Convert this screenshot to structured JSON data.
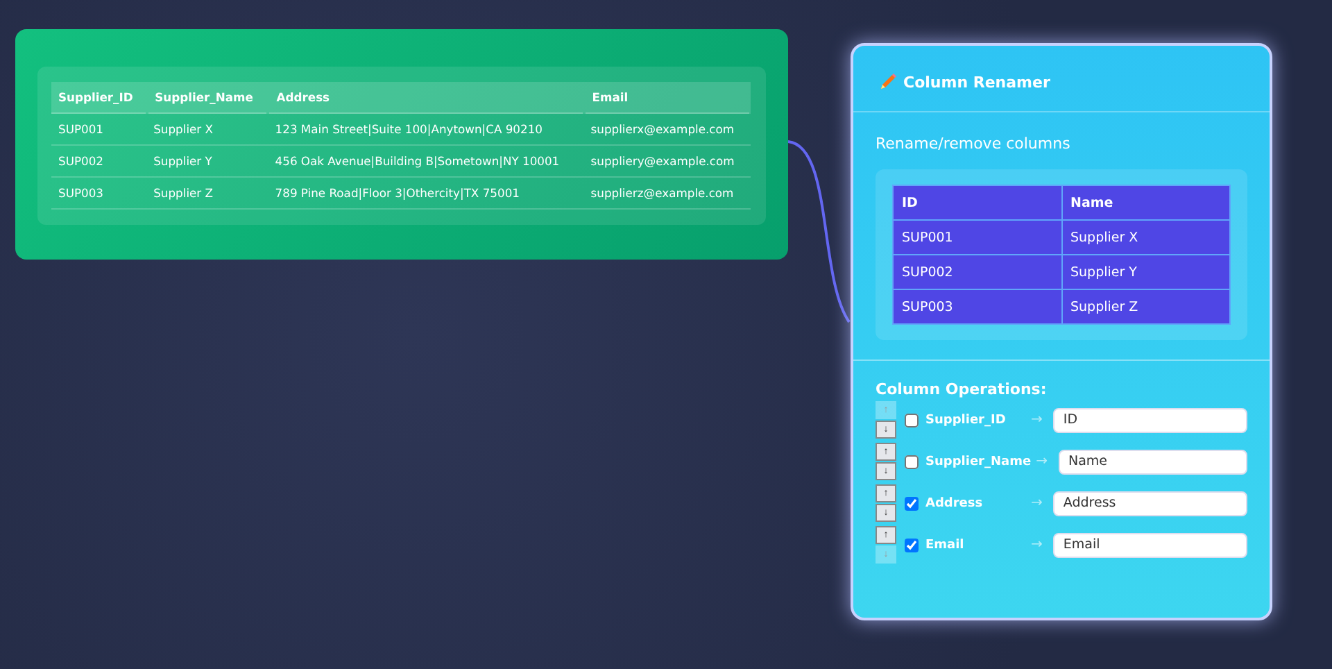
{
  "source_table": {
    "columns": [
      "Supplier_ID",
      "Supplier_Name",
      "Address",
      "Email"
    ],
    "rows": [
      [
        "SUP001",
        "Supplier X",
        "123 Main Street|Suite 100|Anytown|CA 90210",
        "supplierx@example.com"
      ],
      [
        "SUP002",
        "Supplier Y",
        "456 Oak Avenue|Building B|Sometown|NY 10001",
        "suppliery@example.com"
      ],
      [
        "SUP003",
        "Supplier Z",
        "789 Pine Road|Floor 3|Othercity|TX 75001",
        "supplierz@example.com"
      ]
    ]
  },
  "renamer": {
    "title": "Column Renamer",
    "subtitle": "Rename/remove columns",
    "preview": {
      "columns": [
        "ID",
        "Name"
      ],
      "rows": [
        [
          "SUP001",
          "Supplier X"
        ],
        [
          "SUP002",
          "Supplier Y"
        ],
        [
          "SUP003",
          "Supplier Z"
        ]
      ]
    },
    "operations_title": "Column Operations:",
    "operations": [
      {
        "up": "↑",
        "down": "↓",
        "up_disabled": true,
        "down_disabled": false,
        "checked": false,
        "column": "Supplier_ID",
        "arrow": "→",
        "value": "ID"
      },
      {
        "up": "↑",
        "down": "↓",
        "up_disabled": false,
        "down_disabled": false,
        "checked": false,
        "column": "Supplier_Name",
        "arrow": "→",
        "value": "Name"
      },
      {
        "up": "↑",
        "down": "↓",
        "up_disabled": false,
        "down_disabled": false,
        "checked": true,
        "column": "Address",
        "arrow": "→",
        "value": "Address"
      },
      {
        "up": "↑",
        "down": "↓",
        "up_disabled": false,
        "down_disabled": true,
        "checked": true,
        "column": "Email",
        "arrow": "→",
        "value": "Email"
      }
    ]
  }
}
